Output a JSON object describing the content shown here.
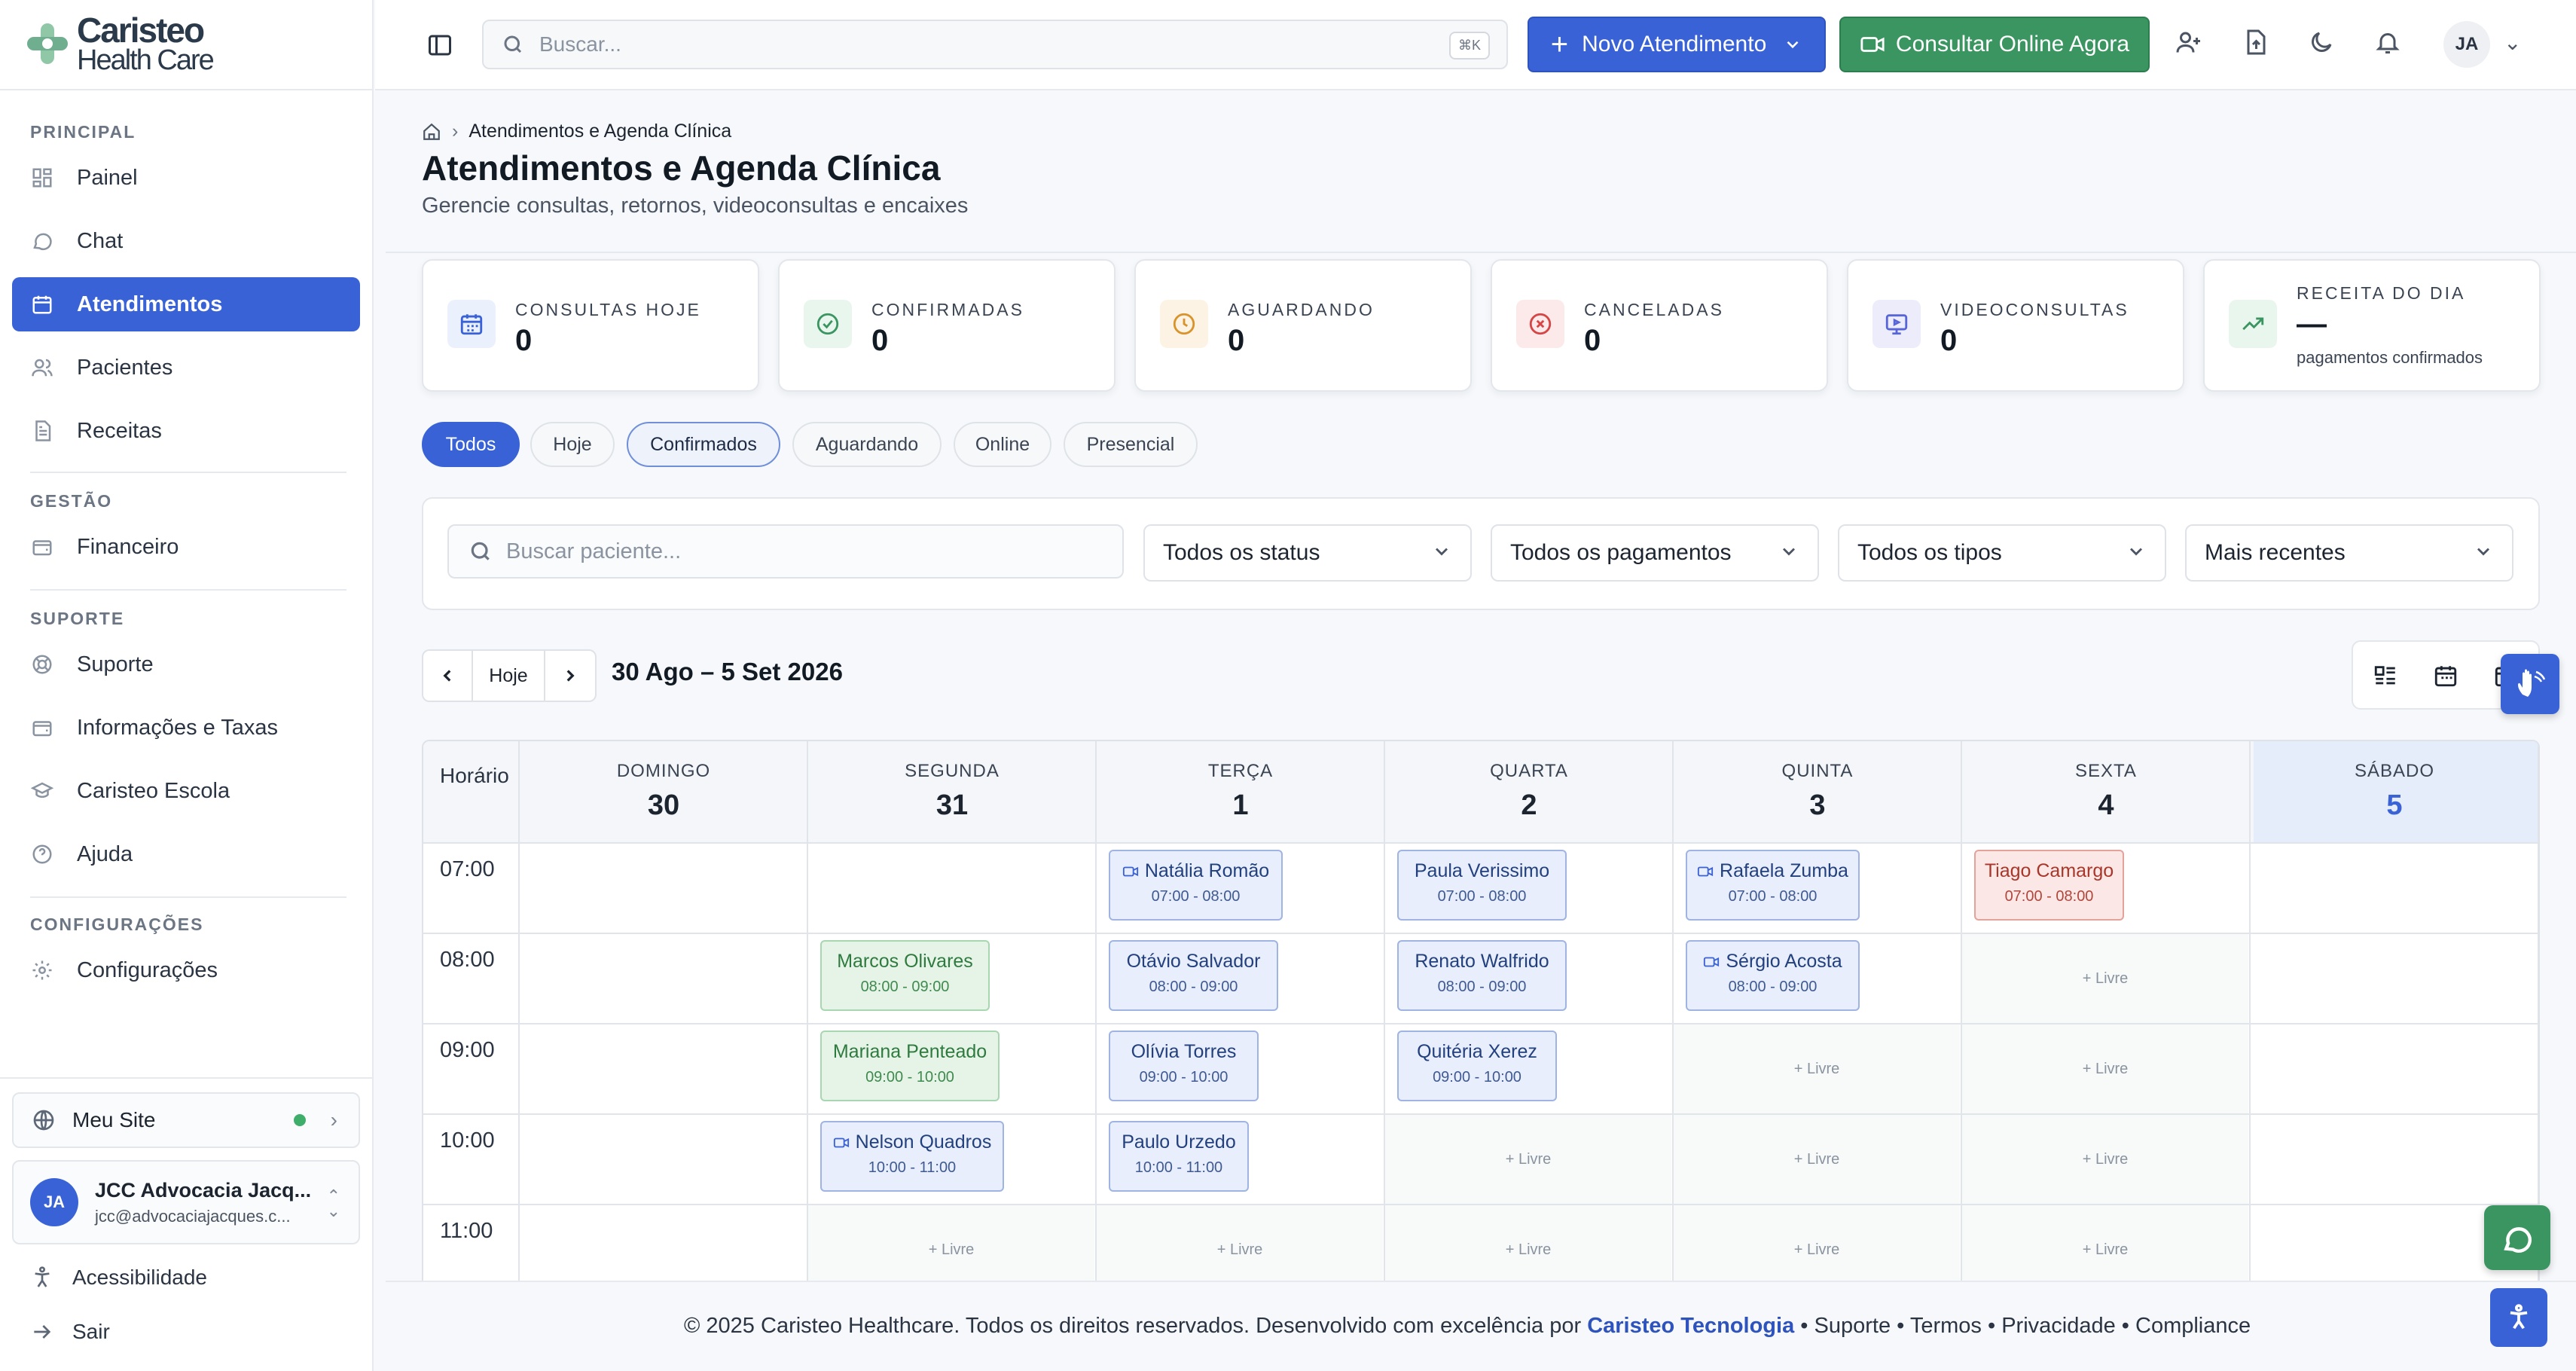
{
  "brand": {
    "line1": "Caristeo",
    "line2": "Health Care"
  },
  "sidebar": {
    "sections": [
      "PRINCIPAL",
      "GESTÃO",
      "SUPORTE",
      "CONFIGURAÇÕES"
    ],
    "items": [
      {
        "label": "Painel",
        "icon": "dashboard-icon"
      },
      {
        "label": "Chat",
        "icon": "chat-icon"
      },
      {
        "label": "Atendimentos",
        "icon": "calendar-icon",
        "active": true
      },
      {
        "label": "Pacientes",
        "icon": "users-icon"
      },
      {
        "label": "Receitas",
        "icon": "document-icon"
      },
      {
        "label": "Financeiro",
        "icon": "wallet-icon"
      },
      {
        "label": "Suporte",
        "icon": "lifebuoy-icon"
      },
      {
        "label": "Informações e Taxas",
        "icon": "wallet-icon"
      },
      {
        "label": "Caristeo Escola",
        "icon": "graduation-cap-icon"
      },
      {
        "label": "Ajuda",
        "icon": "help-circle-icon"
      },
      {
        "label": "Configurações",
        "icon": "gear-icon"
      }
    ],
    "meu_site": "Meu Site",
    "user": {
      "initials": "JA",
      "name": "JCC Advocacia Jacq...",
      "email": "jcc@advocaciajacques.c..."
    },
    "acessibilidade": "Acessibilidade",
    "sair": "Sair"
  },
  "topbar": {
    "search_placeholder": "Buscar...",
    "shortcut": "⌘K",
    "novo_label": "Novo Atendimento",
    "online_label": "Consultar Online Agora",
    "avatar_initials": "JA"
  },
  "header": {
    "breadcrumb": "Atendimentos e Agenda Clínica",
    "title": "Atendimentos e Agenda Clínica",
    "subtitle": "Gerencie consultas, retornos, videoconsultas e encaixes"
  },
  "stats": [
    {
      "label": "CONSULTAS HOJE",
      "value": "0",
      "color": "#3a62d7"
    },
    {
      "label": "CONFIRMADAS",
      "value": "0",
      "color": "#3a9560"
    },
    {
      "label": "AGUARDANDO",
      "value": "0",
      "color": "#d9932b"
    },
    {
      "label": "CANCELADAS",
      "value": "0",
      "color": "#d64545"
    },
    {
      "label": "VIDEOCONSULTAS",
      "value": "0",
      "color": "#5865d6"
    },
    {
      "label": "RECEITA DO DIA",
      "value": "—",
      "note": "pagamentos confirmados",
      "color": "#3a9560"
    }
  ],
  "chips": [
    "Todos",
    "Hoje",
    "Confirmados",
    "Aguardando",
    "Online",
    "Presencial"
  ],
  "filters": {
    "search_placeholder": "Buscar paciente...",
    "status": "Todos os status",
    "pagamentos": "Todos os pagamentos",
    "tipos": "Todos os tipos",
    "ordem": "Mais recentes"
  },
  "calendar": {
    "hoje": "Hoje",
    "range": "30 Ago – 5 Set 2026",
    "horario": "Horário",
    "days": [
      {
        "name": "DOMINGO",
        "num": "30"
      },
      {
        "name": "SEGUNDA",
        "num": "31"
      },
      {
        "name": "TERÇA",
        "num": "1"
      },
      {
        "name": "QUARTA",
        "num": "2"
      },
      {
        "name": "QUINTA",
        "num": "3"
      },
      {
        "name": "SEXTA",
        "num": "4"
      },
      {
        "name": "SÁBADO",
        "num": "5"
      }
    ],
    "times": [
      "07:00",
      "08:00",
      "09:00",
      "10:00",
      "11:00"
    ],
    "free_label": "+ Livre",
    "appointments": [
      {
        "day": 2,
        "slot": 0,
        "name": "Natália Romão",
        "time": "07:00 - 08:00",
        "color": "blue",
        "video": true
      },
      {
        "day": 3,
        "slot": 0,
        "name": "Paula Verissimo",
        "time": "07:00 - 08:00",
        "color": "blue",
        "video": false
      },
      {
        "day": 4,
        "slot": 0,
        "name": "Rafaela Zumba",
        "time": "07:00 - 08:00",
        "color": "blue",
        "video": true
      },
      {
        "day": 5,
        "slot": 0,
        "name": "Tiago Camargo",
        "time": "07:00 - 08:00",
        "color": "red",
        "video": false
      },
      {
        "day": 1,
        "slot": 1,
        "name": "Marcos Olivares",
        "time": "08:00 - 09:00",
        "color": "green",
        "video": false
      },
      {
        "day": 2,
        "slot": 1,
        "name": "Otávio Salvador",
        "time": "08:00 - 09:00",
        "color": "blue",
        "video": false
      },
      {
        "day": 3,
        "slot": 1,
        "name": "Renato Walfrido",
        "time": "08:00 - 09:00",
        "color": "blue",
        "video": false
      },
      {
        "day": 4,
        "slot": 1,
        "name": "Sérgio Acosta",
        "time": "08:00 - 09:00",
        "color": "blue",
        "video": true
      },
      {
        "day": 1,
        "slot": 2,
        "name": "Mariana Penteado",
        "time": "09:00 - 10:00",
        "color": "green",
        "video": false
      },
      {
        "day": 2,
        "slot": 2,
        "name": "Olívia Torres",
        "time": "09:00 - 10:00",
        "color": "blue",
        "video": false
      },
      {
        "day": 3,
        "slot": 2,
        "name": "Quitéria Xerez",
        "time": "09:00 - 10:00",
        "color": "blue",
        "video": false
      },
      {
        "day": 1,
        "slot": 3,
        "name": "Nelson Quadros",
        "time": "10:00 - 11:00",
        "color": "blue",
        "video": true
      },
      {
        "day": 2,
        "slot": 3,
        "name": "Paulo Urzedo",
        "time": "10:00 - 11:00",
        "color": "blue",
        "video": false
      }
    ],
    "free_cells": [
      {
        "day": 5,
        "slot": 1
      },
      {
        "day": 4,
        "slot": 2
      },
      {
        "day": 5,
        "slot": 2
      },
      {
        "day": 3,
        "slot": 3
      },
      {
        "day": 4,
        "slot": 3
      },
      {
        "day": 5,
        "slot": 3
      },
      {
        "day": 1,
        "slot": 4
      },
      {
        "day": 2,
        "slot": 4
      },
      {
        "day": 3,
        "slot": 4
      },
      {
        "day": 4,
        "slot": 4
      },
      {
        "day": 5,
        "slot": 4
      }
    ]
  },
  "footer": {
    "text": "© 2025 Caristeo Healthcare. Todos os direitos reservados. Desenvolvido com excelência por",
    "link": "Caristeo Tecnologia",
    "links": [
      "Suporte",
      "Termos",
      "Privacidade",
      "Compliance"
    ]
  }
}
